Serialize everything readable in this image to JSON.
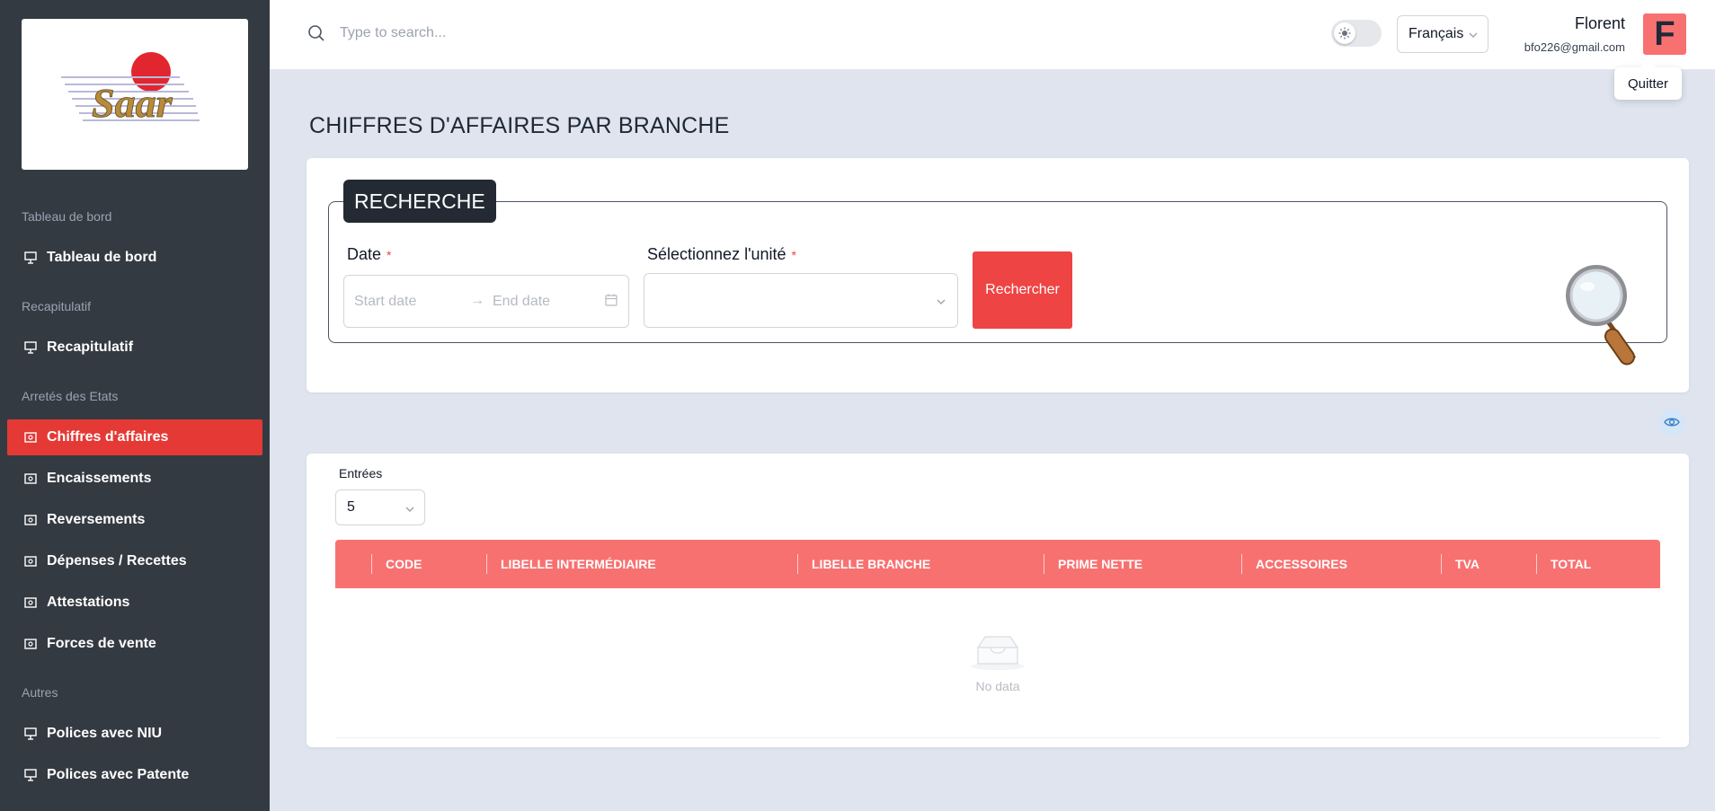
{
  "header": {
    "search_placeholder": "Type to search...",
    "language": "Français",
    "user_name": "Florent",
    "user_email": "bfo226@gmail.com",
    "avatar_letter": "F",
    "quit_tooltip": "Quitter"
  },
  "sidebar": {
    "logo_text": "Saar",
    "sections": [
      {
        "label": "Tableau de bord",
        "items": [
          {
            "label": "Tableau de bord"
          }
        ]
      },
      {
        "label": "Recapitulatif",
        "items": [
          {
            "label": "Recapitulatif"
          }
        ]
      },
      {
        "label": "Arretés des Etats",
        "items": [
          {
            "label": "Chiffres d'affaires",
            "active": true
          },
          {
            "label": "Encaissements"
          },
          {
            "label": "Reversements"
          },
          {
            "label": "Dépenses / Recettes"
          },
          {
            "label": "Attestations"
          },
          {
            "label": "Forces de vente"
          }
        ]
      },
      {
        "label": "Autres",
        "items": [
          {
            "label": "Polices avec NIU"
          },
          {
            "label": "Polices avec Patente"
          }
        ]
      }
    ]
  },
  "page": {
    "title": "CHIFFRES D'AFFAIRES PAR BRANCHE"
  },
  "search_form": {
    "legend": "RECHERCHE",
    "date_label": "Date",
    "date_required": "*",
    "start_placeholder": "Start date",
    "end_placeholder": "End date",
    "unit_label": "Sélectionnez l'unité",
    "unit_required": "*",
    "unit_value": "",
    "submit_label": "Rechercher"
  },
  "table": {
    "entries_label": "Entrées",
    "entries_value": "5",
    "columns": [
      "CODE",
      "LIBELLE INTERMÉDIAIRE",
      "LIBELLE BRANCHE",
      "PRIME NETTE",
      "ACCESSOIRES",
      "TVA",
      "TOTAL"
    ],
    "rows": [],
    "empty_text": "No data"
  },
  "colors": {
    "sidebar_bg": "#343a42",
    "active_item": "#e53935",
    "accent_red": "#ef4444",
    "table_header": "#f87171",
    "page_bg": "#dfe4ee"
  }
}
